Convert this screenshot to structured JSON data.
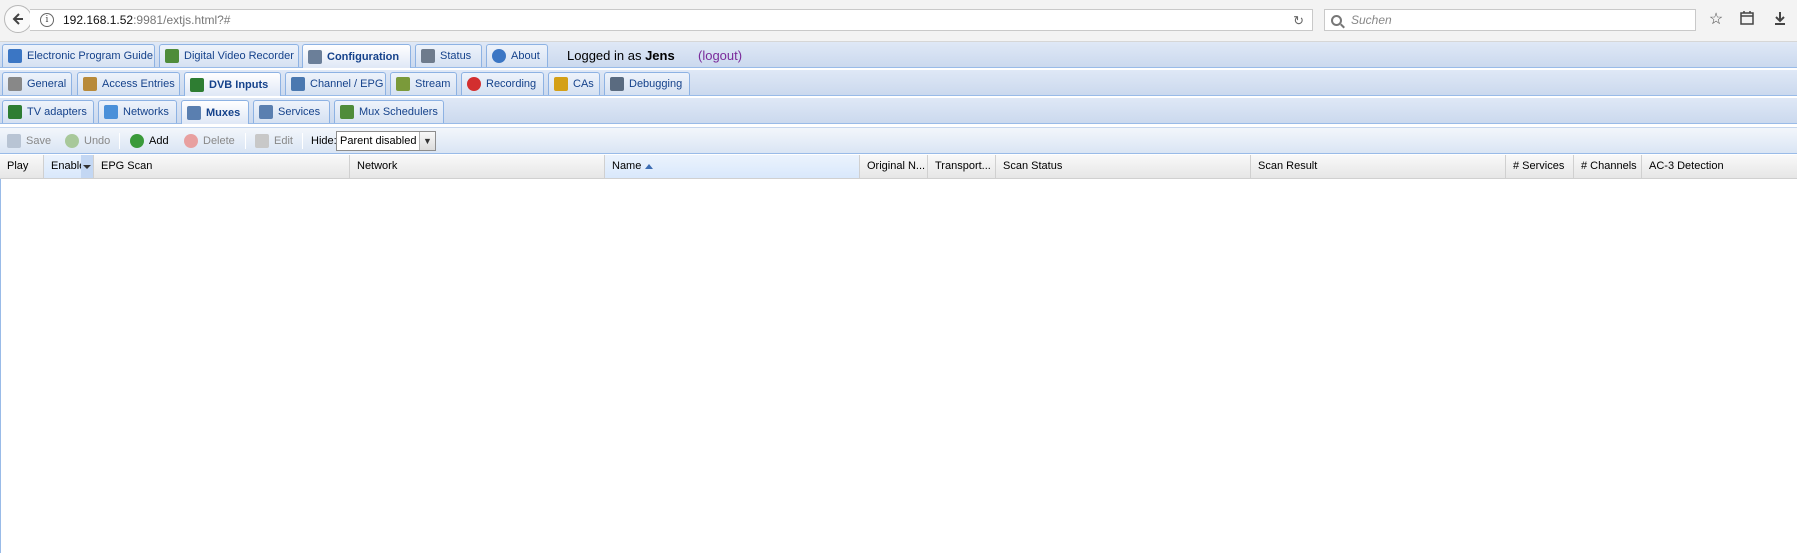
{
  "browser": {
    "url_host": "192.168.1.52",
    "url_rest": ":9981/extjs.html?#",
    "search_placeholder": "Suchen"
  },
  "main_tabs": [
    {
      "label": "Electronic Program Guide",
      "icon": "epg-icon",
      "color": "#3b76c4"
    },
    {
      "label": "Digital Video Recorder",
      "icon": "download-icon",
      "color": "#4f8c3a"
    },
    {
      "label": "Configuration",
      "icon": "wrench-icon",
      "color": "#6b7f99"
    },
    {
      "label": "Status",
      "icon": "eye-icon",
      "color": "#6e7b8c"
    },
    {
      "label": "About",
      "icon": "info-icon",
      "color": "#3b76c4"
    }
  ],
  "login": {
    "prefix": "Logged in as",
    "user": "Jens",
    "logout": "(logout)"
  },
  "config_tabs": [
    {
      "label": "General",
      "icon": "tools-icon",
      "color": "#888888"
    },
    {
      "label": "Access Entries",
      "icon": "users-icon",
      "color": "#b88a3a"
    },
    {
      "label": "DVB Inputs",
      "icon": "card-icon",
      "color": "#2e7d32"
    },
    {
      "label": "Channel / EPG",
      "icon": "tv-icon",
      "color": "#4a78b0"
    },
    {
      "label": "Stream",
      "icon": "stream-icon",
      "color": "#7a9a3a"
    },
    {
      "label": "Recording",
      "icon": "rec-icon",
      "color": "#d32f2f"
    },
    {
      "label": "CAs",
      "icon": "key-icon",
      "color": "#d4a017"
    },
    {
      "label": "Debugging",
      "icon": "bug-icon",
      "color": "#5a6b80"
    }
  ],
  "dvb_tabs": [
    {
      "label": "TV adapters",
      "icon": "adapter-icon",
      "color": "#2e7d32"
    },
    {
      "label": "Networks",
      "icon": "antenna-icon",
      "color": "#4a90d9"
    },
    {
      "label": "Muxes",
      "icon": "mux-icon",
      "color": "#5a7fb0"
    },
    {
      "label": "Services",
      "icon": "services-icon",
      "color": "#5a7fb0"
    },
    {
      "label": "Mux Schedulers",
      "icon": "scheduler-icon",
      "color": "#4f8c3a"
    }
  ],
  "toolbar": {
    "save": "Save",
    "undo": "Undo",
    "add": "Add",
    "delete": "Delete",
    "edit": "Edit",
    "hide_label": "Hide:",
    "hide_value": "Parent disabled"
  },
  "columns": [
    "Play",
    "Enable",
    "EPG Scan",
    "Network",
    "Name",
    "Original N...",
    "Transport...",
    "Scan Status",
    "Scan Result",
    "# Services",
    "# Channels",
    "AC-3 Detection"
  ]
}
